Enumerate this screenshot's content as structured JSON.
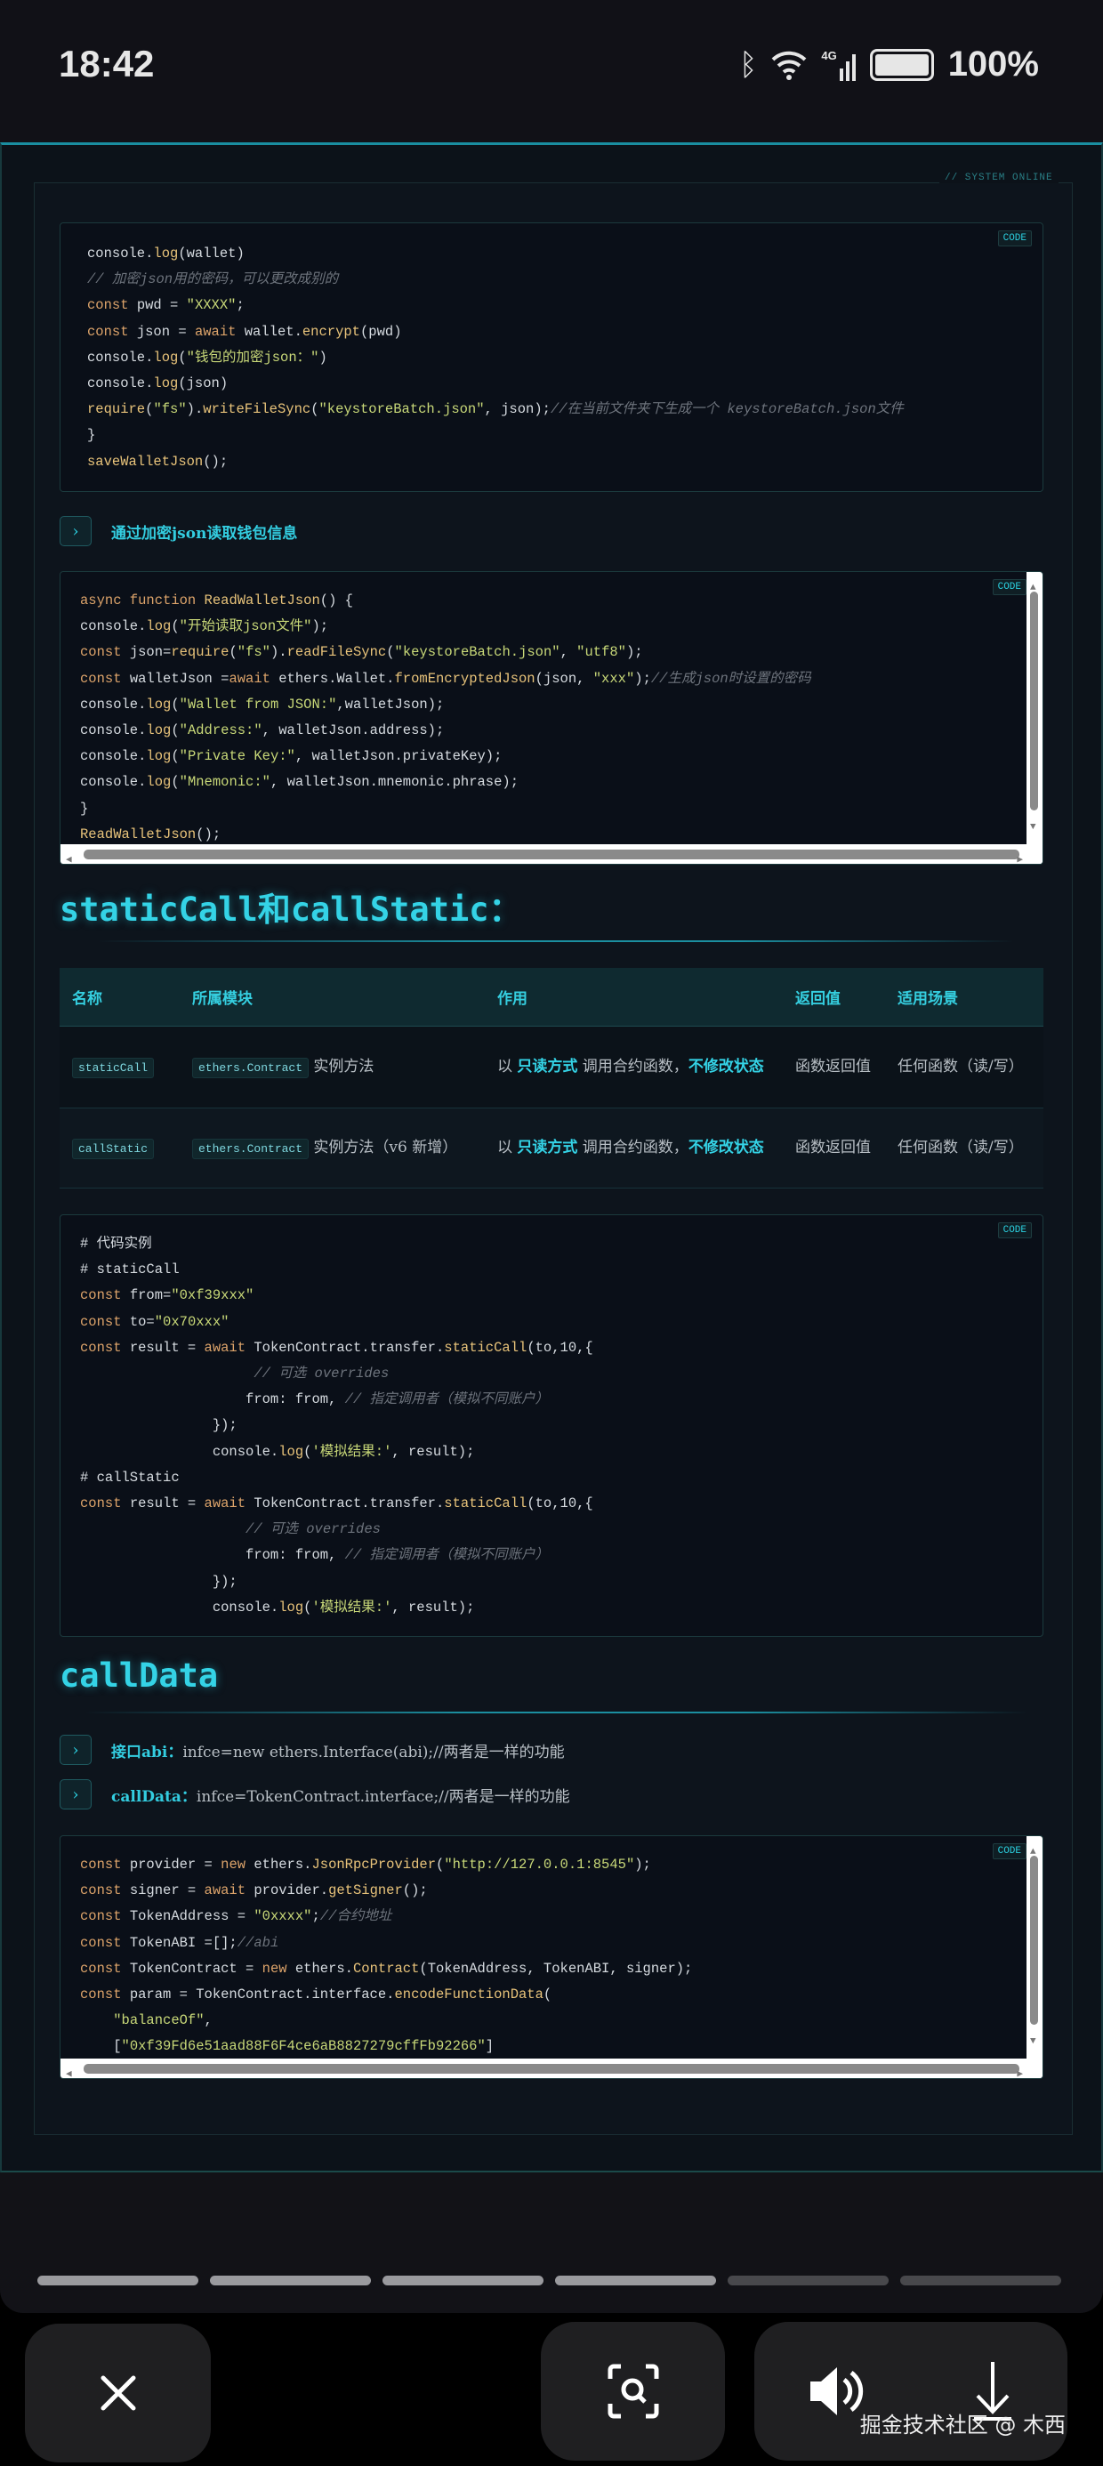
{
  "status_bar": {
    "time": "18:42",
    "battery": "100%",
    "network": "4G"
  },
  "system_tag": "// SYSTEM ONLINE",
  "code_badge": "CODE",
  "code_blocks": [
    {
      "lines": [
        [
          [
            "pl",
            "console."
          ],
          [
            "fn",
            "log"
          ],
          [
            "pl",
            "(wallet)"
          ]
        ],
        [
          [
            "cm",
            "// 加密json用的密码，可以更改成别的"
          ]
        ],
        [
          [
            "kw",
            "const"
          ],
          [
            "pl",
            " pwd = "
          ],
          [
            "str",
            "\"XXXX\""
          ],
          [
            "pl",
            ";"
          ]
        ],
        [
          [
            "kw",
            "const"
          ],
          [
            "pl",
            " json = "
          ],
          [
            "kw",
            "await"
          ],
          [
            "pl",
            " wallet."
          ],
          [
            "fn",
            "encrypt"
          ],
          [
            "pl",
            "(pwd)"
          ]
        ],
        [
          [
            "pl",
            "console."
          ],
          [
            "fn",
            "log"
          ],
          [
            "pl",
            "("
          ],
          [
            "str",
            "\"钱包的加密json：\""
          ],
          [
            "pl",
            ")"
          ]
        ],
        [
          [
            "pl",
            "console."
          ],
          [
            "fn",
            "log"
          ],
          [
            "pl",
            "(json)"
          ]
        ],
        [
          [
            "fn",
            "require"
          ],
          [
            "pl",
            "("
          ],
          [
            "str",
            "\"fs\""
          ],
          [
            "pl",
            ")."
          ],
          [
            "fn",
            "writeFileSync"
          ],
          [
            "pl",
            "("
          ],
          [
            "str",
            "\"keystoreBatch.json\""
          ],
          [
            "pl",
            ", json);"
          ],
          [
            "cm",
            "//在当前文件夹下生成一个 keystoreBatch.json文件"
          ]
        ],
        [
          [
            "pl",
            "}"
          ]
        ],
        [
          [
            "fn",
            "saveWalletJson"
          ],
          [
            "pl",
            "();"
          ]
        ]
      ]
    },
    {
      "lines": [
        [
          [
            "kw",
            "async function"
          ],
          [
            "pl",
            " "
          ],
          [
            "fn",
            "ReadWalletJson"
          ],
          [
            "pl",
            "() {"
          ]
        ],
        [
          [
            "pl",
            "console."
          ],
          [
            "fn",
            "log"
          ],
          [
            "pl",
            "("
          ],
          [
            "str",
            "\"开始读取json文件\""
          ],
          [
            "pl",
            ");"
          ]
        ],
        [
          [
            "kw",
            "const"
          ],
          [
            "pl",
            " json="
          ],
          [
            "fn",
            "require"
          ],
          [
            "pl",
            "("
          ],
          [
            "str",
            "\"fs\""
          ],
          [
            "pl",
            ")."
          ],
          [
            "fn",
            "readFileSync"
          ],
          [
            "pl",
            "("
          ],
          [
            "str",
            "\"keystoreBatch.json\""
          ],
          [
            "pl",
            ", "
          ],
          [
            "str",
            "\"utf8\""
          ],
          [
            "pl",
            ");"
          ]
        ],
        [
          [
            "kw",
            "const"
          ],
          [
            "pl",
            " walletJson ="
          ],
          [
            "kw",
            "await"
          ],
          [
            "pl",
            " ethers.Wallet."
          ],
          [
            "fn",
            "fromEncryptedJson"
          ],
          [
            "pl",
            "(json, "
          ],
          [
            "str",
            "\"xxx\""
          ],
          [
            "pl",
            ");"
          ],
          [
            "cm",
            "//生成json时设置的密码"
          ]
        ],
        [
          [
            "pl",
            "console."
          ],
          [
            "fn",
            "log"
          ],
          [
            "pl",
            "("
          ],
          [
            "str",
            "\"Wallet from JSON:\""
          ],
          [
            "pl",
            ",walletJson);"
          ]
        ],
        [
          [
            "pl",
            "console."
          ],
          [
            "fn",
            "log"
          ],
          [
            "pl",
            "("
          ],
          [
            "str",
            "\"Address:\""
          ],
          [
            "pl",
            ", walletJson.address);"
          ]
        ],
        [
          [
            "pl",
            "console."
          ],
          [
            "fn",
            "log"
          ],
          [
            "pl",
            "("
          ],
          [
            "str",
            "\"Private Key:\""
          ],
          [
            "pl",
            ", walletJson.privateKey);"
          ]
        ],
        [
          [
            "pl",
            "console."
          ],
          [
            "fn",
            "log"
          ],
          [
            "pl",
            "("
          ],
          [
            "str",
            "\"Mnemonic:\""
          ],
          [
            "pl",
            ", walletJson.mnemonic.phrase);"
          ]
        ],
        [
          [
            "pl",
            "}"
          ]
        ],
        [
          [
            "fn",
            "ReadWalletJson"
          ],
          [
            "pl",
            "();"
          ]
        ]
      ]
    },
    {
      "lines": [
        [
          [
            "pl",
            "# 代码实例"
          ]
        ],
        [
          [
            "pl",
            "# staticCall"
          ]
        ],
        [
          [
            "kw",
            "const"
          ],
          [
            "pl",
            " from="
          ],
          [
            "str",
            "\"0xf39xxx\""
          ]
        ],
        [
          [
            "kw",
            "const"
          ],
          [
            "pl",
            " to="
          ],
          [
            "str",
            "\"0x70xxx\""
          ]
        ],
        [
          [
            "kw",
            "const"
          ],
          [
            "pl",
            " result = "
          ],
          [
            "kw",
            "await"
          ],
          [
            "pl",
            " TokenContract.transfer."
          ],
          [
            "fn",
            "staticCall"
          ],
          [
            "pl",
            "(to,10,{"
          ]
        ],
        [
          [
            "pl",
            "                     "
          ],
          [
            "cm",
            "// 可选 overrides"
          ]
        ],
        [
          [
            "pl",
            "                    from: from, "
          ],
          [
            "cm",
            "// 指定调用者（模拟不同账户）"
          ]
        ],
        [
          [
            "pl",
            "                });"
          ]
        ],
        [
          [
            "pl",
            "                console."
          ],
          [
            "fn",
            "log"
          ],
          [
            "pl",
            "("
          ],
          [
            "str",
            "'模拟结果:'"
          ],
          [
            "pl",
            ", result);"
          ]
        ],
        [
          [
            "pl",
            "# callStatic"
          ]
        ],
        [
          [
            "kw",
            "const"
          ],
          [
            "pl",
            " result = "
          ],
          [
            "kw",
            "await"
          ],
          [
            "pl",
            " TokenContract.transfer."
          ],
          [
            "fn",
            "staticCall"
          ],
          [
            "pl",
            "(to,10,{"
          ]
        ],
        [
          [
            "pl",
            "                    "
          ],
          [
            "cm",
            "// 可选 overrides"
          ]
        ],
        [
          [
            "pl",
            "                    from: from, "
          ],
          [
            "cm",
            "// 指定调用者（模拟不同账户）"
          ]
        ],
        [
          [
            "pl",
            "                });"
          ]
        ],
        [
          [
            "pl",
            "                console."
          ],
          [
            "fn",
            "log"
          ],
          [
            "pl",
            "("
          ],
          [
            "str",
            "'模拟结果:'"
          ],
          [
            "pl",
            ", result);"
          ]
        ]
      ]
    },
    {
      "lines": [
        [
          [
            "kw",
            "const"
          ],
          [
            "pl",
            " provider = "
          ],
          [
            "kw",
            "new"
          ],
          [
            "pl",
            " ethers."
          ],
          [
            "fn",
            "JsonRpcProvider"
          ],
          [
            "pl",
            "("
          ],
          [
            "str",
            "\"http://127.0.0.1:8545\""
          ],
          [
            "pl",
            ");"
          ]
        ],
        [
          [
            "kw",
            "const"
          ],
          [
            "pl",
            " signer = "
          ],
          [
            "kw",
            "await"
          ],
          [
            "pl",
            " provider."
          ],
          [
            "fn",
            "getSigner"
          ],
          [
            "pl",
            "();"
          ]
        ],
        [
          [
            "kw",
            "const"
          ],
          [
            "pl",
            " TokenAddress = "
          ],
          [
            "str",
            "\"0xxxx\""
          ],
          [
            "pl",
            ";"
          ],
          [
            "cm",
            "//合约地址"
          ]
        ],
        [
          [
            "kw",
            "const"
          ],
          [
            "pl",
            " TokenABI =[];"
          ],
          [
            "cm",
            "//abi"
          ]
        ],
        [
          [
            "kw",
            "const"
          ],
          [
            "pl",
            " TokenContract = "
          ],
          [
            "kw",
            "new"
          ],
          [
            "pl",
            " ethers."
          ],
          [
            "fn",
            "Contract"
          ],
          [
            "pl",
            "(TokenAddress, TokenABI, signer);"
          ]
        ],
        [
          [
            "kw",
            "const"
          ],
          [
            "pl",
            " param = TokenContract.interface."
          ],
          [
            "fn",
            "encodeFunctionData"
          ],
          [
            "pl",
            "("
          ]
        ],
        [
          [
            "pl",
            "    "
          ],
          [
            "str",
            "\"balanceOf\""
          ],
          [
            "pl",
            ","
          ]
        ],
        [
          [
            "pl",
            "    ["
          ],
          [
            "str",
            "\"0xf39Fd6e51aad88F6F4ce6aB8827279cffFb92266\""
          ],
          [
            "pl",
            "]"
          ]
        ]
      ]
    }
  ],
  "bullets": [
    {
      "label": "通过加密json读取钱包信息",
      "text": ""
    },
    {
      "label": "接口abi：",
      "text": "infce=new ethers.Interface(abi);//两者是一样的功能"
    },
    {
      "label": "callData：",
      "text": "infce=TokenContract.interface;//两者是一样的功能"
    }
  ],
  "headings": {
    "static": "staticCall和callStatic：",
    "calldata": "callData"
  },
  "table": {
    "headers": [
      "名称",
      "所属模块",
      "作用",
      "返回值",
      "适用场景"
    ],
    "rows": [
      {
        "name": "staticCall",
        "module_tag": "ethers.Contract",
        "module_text": " 实例方法",
        "effect": [
          "以 ",
          "只读方式",
          " 调用合约函数，",
          "不修改状态"
        ],
        "returns": "函数返回值",
        "scene": "任何函数（读/写）"
      },
      {
        "name": "callStatic",
        "module_tag": "ethers.Contract",
        "module_text": " 实例方法（v6 新增）",
        "effect": [
          "以 ",
          "只读方式",
          " 调用合约函数，",
          "不修改状态"
        ],
        "returns": "函数返回值",
        "scene": "任何函数（读/写）"
      }
    ]
  },
  "progress": {
    "segments": 6,
    "completed": 4
  },
  "watermark": "掘金技术社区 @ 木西",
  "colors": {
    "accent": "#34d3e6",
    "bg": "#0c1219",
    "keyword": "#dca36a",
    "string": "#c8d878"
  }
}
